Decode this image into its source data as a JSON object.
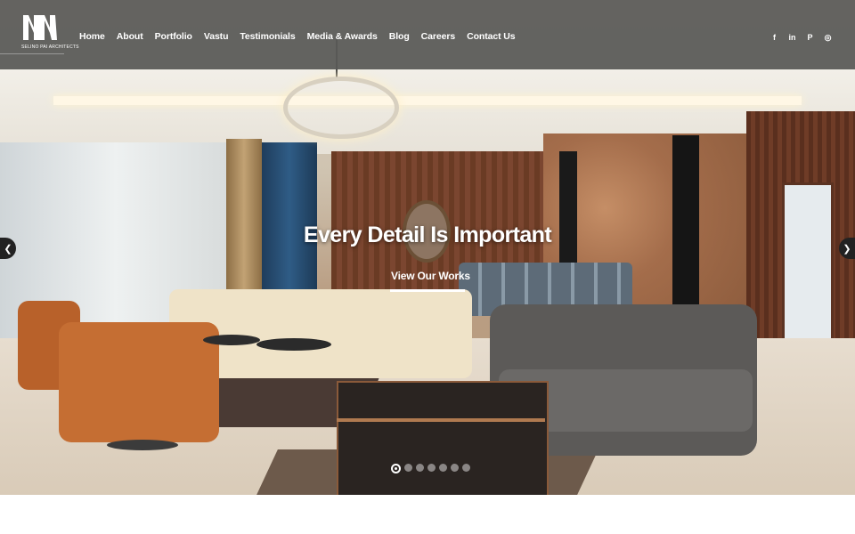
{
  "brand": {
    "logo_text": "SELINO PAI ARCHITECTS"
  },
  "nav": [
    {
      "label": "Home"
    },
    {
      "label": "About"
    },
    {
      "label": "Portfolio"
    },
    {
      "label": "Vastu"
    },
    {
      "label": "Testimonials"
    },
    {
      "label": "Media & Awards"
    },
    {
      "label": "Blog"
    },
    {
      "label": "Careers"
    },
    {
      "label": "Contact Us"
    }
  ],
  "social": [
    {
      "icon": "facebook-icon",
      "glyph": "f"
    },
    {
      "icon": "linkedin-icon",
      "glyph": "in"
    },
    {
      "icon": "pinterest-icon",
      "glyph": "P"
    },
    {
      "icon": "instagram-icon",
      "glyph": "◎"
    }
  ],
  "hero": {
    "headline": "Every Detail Is Important",
    "cta": "View Our Works",
    "prev_glyph": "❮",
    "next_glyph": "❯"
  },
  "slider": {
    "active_index": 0,
    "count": 7
  },
  "colors": {
    "header_overlay": "#5a5a58",
    "text": "#ffffff",
    "arrow_bg": "#222222"
  }
}
